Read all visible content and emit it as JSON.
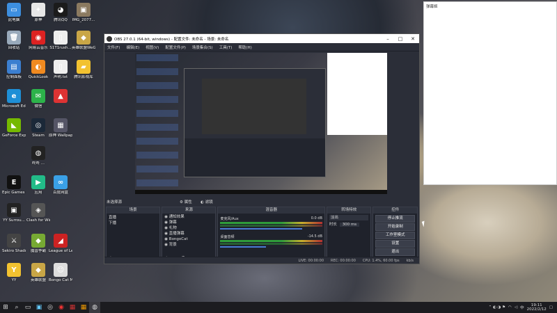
{
  "desktop_icons": [
    {
      "label": "此电脑",
      "color": "#3d8fe0",
      "glyph": "▭",
      "icon": "computer-icon"
    },
    {
      "label": "原神",
      "color": "#e7e7e7",
      "glyph": "✦",
      "icon": "game-icon"
    },
    {
      "label": "腾讯QQ",
      "color": "#1b1b1b",
      "glyph": "◕",
      "icon": "qq-icon"
    },
    {
      "label": "IMG_2077...",
      "color": "#8b7a60",
      "glyph": "▣",
      "icon": "image-file-icon"
    },
    {
      "label": "回收站",
      "color": "#9ab",
      "glyph": "🗑",
      "icon": "recycle-bin-icon"
    },
    {
      "label": "网易云音乐",
      "color": "#d22",
      "glyph": "◉",
      "icon": "music-icon"
    },
    {
      "label": "S1T1rush...",
      "color": "#eee",
      "glyph": "▯",
      "icon": "file-icon"
    },
    {
      "label": "英雄联盟WeGame版",
      "color": "#c9a646",
      "glyph": "◆",
      "icon": "lol-icon"
    },
    {
      "label": "控制面板",
      "color": "#3b7fd0",
      "glyph": "▤",
      "icon": "control-panel-icon"
    },
    {
      "label": "QuickLook",
      "color": "#f08a20",
      "glyph": "◐",
      "icon": "app-icon"
    },
    {
      "label": "声明.txt",
      "color": "#eee",
      "glyph": "▯",
      "icon": "text-file-icon"
    },
    {
      "label": "腾讯影视库",
      "color": "#f2c230",
      "glyph": "▰",
      "icon": "folder-icon"
    },
    {
      "label": "Microsoft Edge",
      "color": "#1e8fd6",
      "glyph": "e",
      "icon": "edge-icon"
    },
    {
      "label": "微信",
      "color": "#2cb34a",
      "glyph": "✉",
      "icon": "wechat-icon"
    },
    {
      "label": "",
      "color": "#d33",
      "glyph": "▲",
      "icon": "app-icon"
    },
    {
      "label": "GeForce Experience",
      "color": "#76b900",
      "glyph": "◣",
      "icon": "nvidia-icon"
    },
    {
      "label": "Steam",
      "color": "#1b2838",
      "glyph": "◎",
      "icon": "steam-icon"
    },
    {
      "label": "原神 Wallpaper",
      "color": "#556",
      "glyph": "▦",
      "icon": "app-icon"
    },
    {
      "label": "咚咚 ...",
      "color": "#222",
      "glyph": "◍",
      "icon": "app-icon"
    },
    {
      "label": "Epic Games Launcher",
      "color": "#111",
      "glyph": "E",
      "icon": "epic-icon"
    },
    {
      "label": "应用",
      "color": "#2b8",
      "glyph": "▶",
      "icon": "play-store-icon"
    },
    {
      "label": "百度网盘",
      "color": "#3aa0e6",
      "glyph": "∞",
      "icon": "cloud-icon"
    },
    {
      "label": "YY Surrou...",
      "color": "#222",
      "glyph": "▣",
      "icon": "app-icon"
    },
    {
      "label": "Clash for Windows...",
      "color": "#555",
      "glyph": "◈",
      "icon": "clash-icon"
    },
    {
      "label": "Sekiro Shadows ...",
      "color": "#444",
      "glyph": "⚔",
      "icon": "game-icon"
    },
    {
      "label": "魔兽争霸",
      "color": "#7a3",
      "glyph": "◆",
      "icon": "game-icon"
    },
    {
      "label": "League of Legends",
      "color": "#c22",
      "glyph": "◢",
      "icon": "lol-icon"
    },
    {
      "label": "YY",
      "color": "#f2c230",
      "glyph": "Y",
      "icon": "yy-icon"
    },
    {
      "label": "英雄联盟",
      "color": "#c9a646",
      "glyph": "◆",
      "icon": "lol-icon"
    },
    {
      "label": "Bongo Cat Mver.exe",
      "color": "#ddd",
      "glyph": "☺",
      "icon": "bongo-cat-icon"
    }
  ],
  "obs": {
    "title": "OBS 27.0.1 (64-bit, windows) - 配置文件: 未命名 - 场景: 未命名",
    "menu": [
      "文件(F)",
      "编辑(E)",
      "视图(V)",
      "配置文件(P)",
      "场景集合(S)",
      "工具(T)",
      "帮助(H)"
    ],
    "scene_label": "未选择源",
    "props_label": "属性",
    "filters_label": "滤镜",
    "docks": {
      "scenes": {
        "title": "场景",
        "items": [
          "直播",
          "下播"
        ]
      },
      "sources": {
        "title": "来源",
        "items": [
          "通知效果",
          "弹幕",
          "礼物",
          "直播弹幕",
          "BongoCat",
          "背景"
        ]
      },
      "mixer": {
        "title": "混音器",
        "channels": [
          {
            "name": "麦克风/Aux",
            "db": "0.0 dB"
          },
          {
            "name": "桌面音频",
            "db": "-14.5 dB"
          }
        ]
      },
      "transitions": {
        "title": "转场特效",
        "type": "淡出",
        "duration_label": "时长",
        "duration": "300 ms"
      },
      "controls": {
        "title": "控件",
        "buttons": [
          "停止推流",
          "开始录制",
          "工作室模式",
          "设置",
          "退出"
        ]
      }
    },
    "status": {
      "live": "LIVE: 00:00:00",
      "rec": "REC: 00:00:00",
      "cpu": "CPU: 1.4%, 60.00 fps",
      "kbps": "kb/s"
    }
  },
  "right_panel": {
    "title": "弹幕姬"
  },
  "taskbar": {
    "items": [
      "windows-start",
      "search",
      "task-view",
      "bilibili",
      "steam",
      "netease",
      "vscode",
      "app",
      "obs"
    ],
    "tray_text": "中",
    "time": "19:11",
    "date": "2022/2/12"
  }
}
